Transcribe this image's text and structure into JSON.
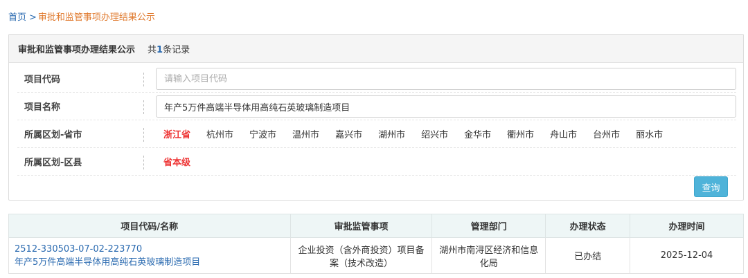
{
  "breadcrumb": {
    "home": "首页",
    "separator": ">",
    "current": "审批和监管事项办理结果公示"
  },
  "panel": {
    "title": "审批和监管事项办理结果公示",
    "count_prefix": "共",
    "count": "1",
    "count_suffix": "条记录"
  },
  "filters": {
    "code": {
      "label": "项目代码",
      "value": "",
      "placeholder": "请输入项目代码"
    },
    "name": {
      "label": "项目名称",
      "value": "年产5万件高端半导体用高纯石英玻璃制造项目",
      "placeholder": ""
    },
    "province": {
      "label": "所属区划-省市",
      "options": [
        "浙江省",
        "杭州市",
        "宁波市",
        "温州市",
        "嘉兴市",
        "湖州市",
        "绍兴市",
        "金华市",
        "衢州市",
        "舟山市",
        "台州市",
        "丽水市"
      ],
      "selected": "浙江省"
    },
    "county": {
      "label": "所属区划-区县",
      "options": [
        "省本级"
      ],
      "selected": "省本级"
    },
    "query_label": "查询"
  },
  "table": {
    "headers": [
      "项目代码/名称",
      "审批监管事项",
      "管理部门",
      "办理状态",
      "办理时间"
    ],
    "rows": [
      {
        "code": "2512-330503-07-02-223770",
        "name": "年产5万件高端半导体用高纯石英玻璃制造项目",
        "matter": "企业投资（含外商投资）项目备案（技术改造）",
        "dept": "湖州市南浔区经济和信息化局",
        "status": "已办结",
        "date": "2025-12-04"
      }
    ]
  },
  "colors": {
    "link": "#2a6ab0",
    "breadcrumb_current": "#e07a2e",
    "active_option": "#e33333",
    "button": "#4fb3d9",
    "table_header_bg": "#eef6f6"
  }
}
